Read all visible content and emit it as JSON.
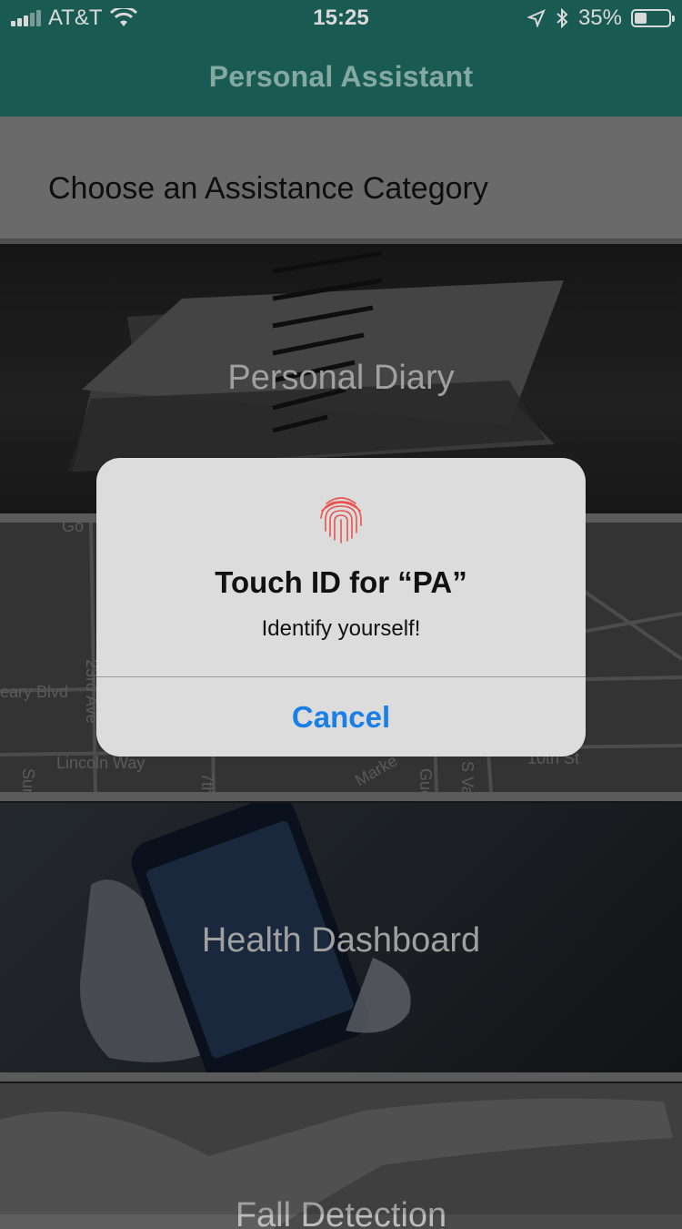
{
  "status_bar": {
    "carrier": "AT&T",
    "time": "15:25",
    "battery_percent": "35%",
    "battery_level": 0.35,
    "icons": [
      "signal-icon",
      "wifi-icon",
      "location-arrow-icon",
      "bluetooth-icon",
      "battery-icon"
    ]
  },
  "nav": {
    "title": "Personal Assistant"
  },
  "header": {
    "text": "Choose an Assistance Category"
  },
  "categories": [
    {
      "label": "Personal Diary"
    },
    {
      "label": ""
    },
    {
      "label": "Health Dashboard"
    },
    {
      "label": "Fall Detection"
    }
  ],
  "map_labels": [
    "eary Blvd",
    "Lincoln Way",
    "23rd Ave",
    "7th",
    "Marke",
    "Gue",
    "S Va",
    "10th St",
    "Sun",
    "Go"
  ],
  "alert": {
    "icon": "fingerprint-icon",
    "title": "Touch ID for “PA”",
    "message": "Identify yourself!",
    "cancel": "Cancel",
    "button_color": "#1a7ee8"
  },
  "colors": {
    "nav_bg": "#1e6b61",
    "nav_title": "#9cc7bf"
  }
}
